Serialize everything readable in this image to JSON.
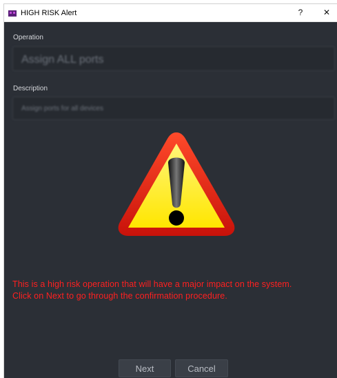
{
  "window": {
    "title": "HIGH RISK Alert",
    "help_label": "?",
    "close_label": "✕"
  },
  "operation": {
    "label": "Operation",
    "value": "Assign ALL ports"
  },
  "description": {
    "label": "Description",
    "value": "Assign ports for all devices"
  },
  "warning_icon": "warning-triangle-icon",
  "message": {
    "line1": "This is a high risk operation that will have a major impact on the system.",
    "line2": "Click on Next to go through the confirmation procedure."
  },
  "buttons": {
    "next": "Next",
    "cancel": "Cancel"
  },
  "colors": {
    "background": "#2b2f36",
    "message": "#ff2020",
    "warning_fill": "#ffee00",
    "warning_border": "#e62010"
  }
}
